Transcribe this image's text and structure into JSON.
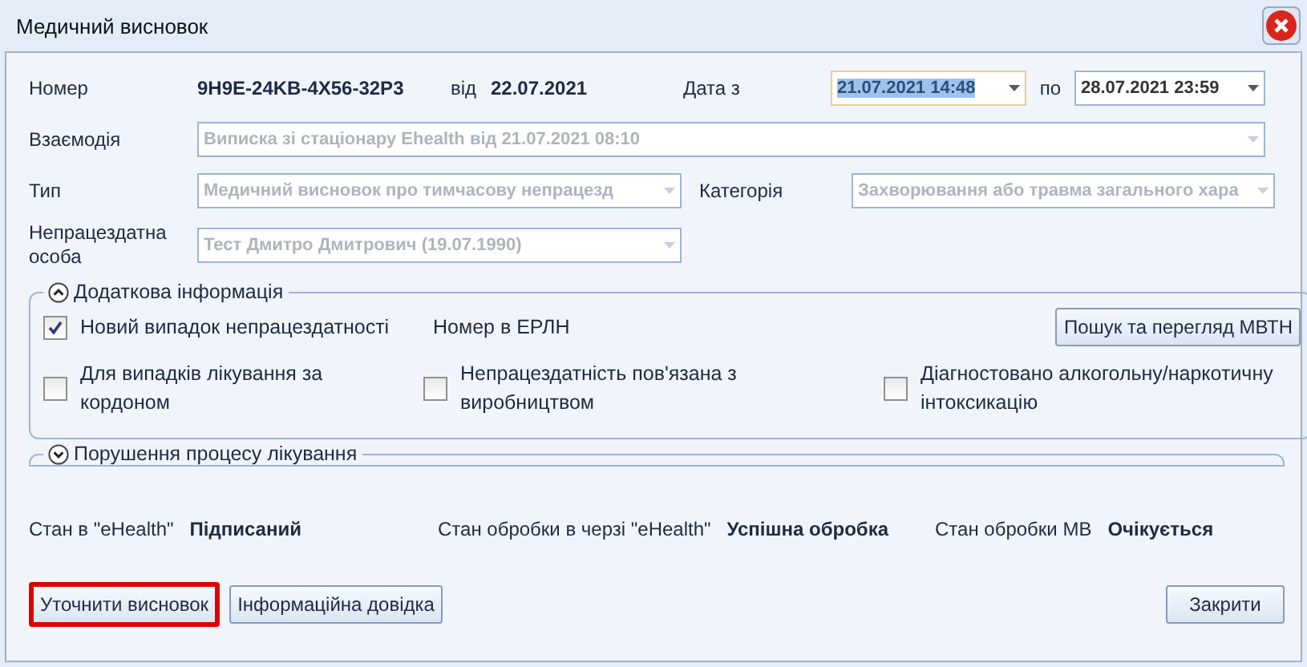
{
  "window": {
    "title": "Медичний висновок"
  },
  "number": {
    "label": "Номер",
    "value": "9H9E-24KB-4X56-32P3",
    "from_label": "від",
    "date": "22.07.2021"
  },
  "date_from": {
    "label": "Дата з",
    "value": "21.07.2021 14:48",
    "focused": true,
    "disabled": false
  },
  "date_to": {
    "label": "по",
    "value": "28.07.2021 23:59",
    "focused": false,
    "disabled": false
  },
  "interaction": {
    "label": "Взаємодія",
    "value": "Виписка зі стаціонару Ehealth від 21.07.2021 08:10",
    "disabled": true
  },
  "type": {
    "label": "Тип",
    "value": "Медичний висновок про тимчасову непрацезд",
    "disabled": true
  },
  "category": {
    "label": "Категорія",
    "value": "Захворювання або травма загального хара",
    "disabled": true
  },
  "person": {
    "label": "Непрацездатна особа",
    "value": "Тест Дмитро Дмитрович (19.07.1990)",
    "disabled": true
  },
  "additional": {
    "title": "Додаткова інформація",
    "expanded": true,
    "new_case": {
      "label": "Новий випадок непрацездатності",
      "checked": true
    },
    "erln_label": "Номер в ЕРЛН",
    "search_button": "Пошук та перегляд МВТН",
    "checkboxes": [
      {
        "label": "Для випадків лікування за кордоном",
        "checked": false
      },
      {
        "label": "Непрацездатність пов'язана з виробництвом",
        "checked": false
      },
      {
        "label": "Діагностовано алкогольну/наркотичну інтоксикацію",
        "checked": false
      }
    ]
  },
  "violations": {
    "title": "Порушення процесу лікування",
    "expanded": false
  },
  "status": [
    {
      "label": "Стан в \"eHealth\"",
      "value": "Підписаний"
    },
    {
      "label": "Стан обробки в черзі \"eHealth\"",
      "value": "Успішна обробка"
    },
    {
      "label": "Стан обробки МВ",
      "value": "Очікується"
    }
  ],
  "buttons": [
    {
      "label": "Уточнити висновок",
      "highlighted": true
    },
    {
      "label": "Інформаційна довідка",
      "highlighted": false
    }
  ],
  "close_button": "Закрити"
}
